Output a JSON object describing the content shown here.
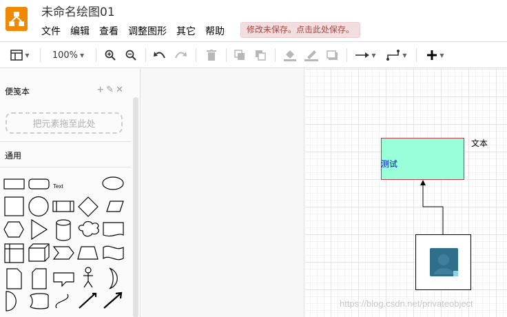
{
  "app": {
    "title": "未命名绘图01",
    "save_notice": "修改未保存。点击此处保存。",
    "logo_icon": "drawio-logo-icon",
    "accent_color": "#f08705"
  },
  "menu": {
    "items": [
      "文件",
      "编辑",
      "查看",
      "调整图形",
      "其它",
      "帮助"
    ]
  },
  "toolbar": {
    "zoom": "100%",
    "icons": [
      "format-panel-icon",
      "zoom-in-icon",
      "zoom-out-icon",
      "undo-icon",
      "redo-icon",
      "delete-icon",
      "to-front-icon",
      "to-back-icon",
      "fill-color-icon",
      "line-color-icon",
      "shadow-icon",
      "connection-icon",
      "waypoints-icon",
      "insert-icon"
    ]
  },
  "sidebar": {
    "scratchpad_title": "便笺本",
    "scratchpad_actions": [
      "+",
      "✎",
      "✕"
    ],
    "drop_hint": "把元素拖至此处",
    "general_title": "通用",
    "text_shape_label": "Text"
  },
  "canvas": {
    "rect_label": "测试",
    "rect_fill": "#99ffd9",
    "rect_stroke": "#c0394b",
    "text_label": "文本",
    "watermark": "https://blog.csdn.net/privateobject"
  }
}
